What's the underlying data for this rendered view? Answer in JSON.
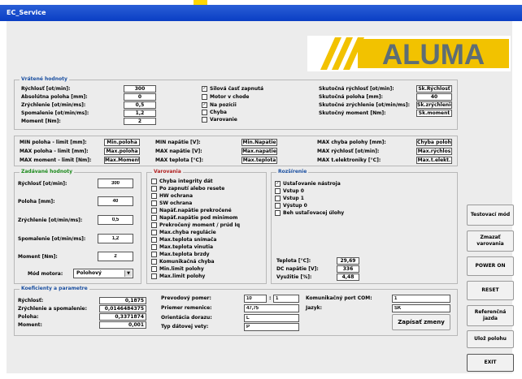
{
  "window": {
    "title": "EC_Service"
  },
  "logo": {
    "text": "ALUMA"
  },
  "vratene": {
    "title": "Vrátené hodnoty",
    "left": [
      {
        "label": "Rýchlosť [ot/min]:",
        "value": "300"
      },
      {
        "label": "Absolútna poloha [mm]:",
        "value": "0"
      },
      {
        "label": "Zrýchlenie [ot/min/ms]:",
        "value": "0,5"
      },
      {
        "label": "Spomalenie [ot/min/ms]:",
        "value": "1,2"
      },
      {
        "label": "Moment [Nm]:",
        "value": "2"
      }
    ],
    "checks": [
      {
        "label": "Silová časť zapnutá",
        "checked": true
      },
      {
        "label": "Motor v chode",
        "checked": false
      },
      {
        "label": "Na pozícii",
        "checked": true
      },
      {
        "label": "Chyba",
        "checked": false
      },
      {
        "label": "Varovanie",
        "checked": false
      }
    ],
    "right": [
      {
        "label": "Skutočná rýchlosť [ot/min]:",
        "value": "Sk.Rýchlosť"
      },
      {
        "label": "Skutočná poloha [mm]:",
        "value": "40"
      },
      {
        "label": "Skutočné zrýchlenie [ot/min/ms]:",
        "value": "Sk.zrýchlenie"
      },
      {
        "label": "Skutočný moment [Nm]:",
        "value": "Sk.moment"
      }
    ]
  },
  "limits": {
    "col1": [
      {
        "label": "MIN poloha - limit [mm]:",
        "value": "Min.poloha"
      },
      {
        "label": "MAX poloha - limit [mm]:",
        "value": "Max.poloha"
      },
      {
        "label": "MAX moment - limit [Nm]:",
        "value": "Max.Moment"
      }
    ],
    "col2": [
      {
        "label": "MIN napätie [V]:",
        "value": "Min.Napatie"
      },
      {
        "label": "MAX napätie [V]:",
        "value": "Max.napatie"
      },
      {
        "label": "MAX teplota [°C]:",
        "value": "Max.teplota"
      }
    ],
    "col3": [
      {
        "label": "MAX chyba polohy [mm]:",
        "value": "Chyba poloh"
      },
      {
        "label": "MAX rýchlosť [ot/min]:",
        "value": "Max.rýchlos"
      },
      {
        "label": "MAX t.elektroniky [°C]:",
        "value": "Max.t.elekt."
      }
    ]
  },
  "zadavane": {
    "title": "Zadávané hodnoty",
    "fields": [
      {
        "label": "Rýchlosť [ot/min]:",
        "value": "300"
      },
      {
        "label": "Poloha [mm]:",
        "value": "40"
      },
      {
        "label": "Zrýchlenie [ot/min/ms]:",
        "value": "0,5"
      },
      {
        "label": "Spomalenie [ot/min/ms]:",
        "value": "1,2"
      },
      {
        "label": "Moment [Nm]:",
        "value": "2"
      }
    ],
    "mode_label": "Mód motora:",
    "mode_value": "Polohový"
  },
  "varovania": {
    "title": "Varovania",
    "items": [
      "Chyba integrity dát",
      "Po zapnutí alebo resete",
      "HW ochrana",
      "SW ochrana",
      "Napäť.napätie prekročené",
      "Napäť.napätie pod minimom",
      "Prekročený moment / prúd Iq",
      "Max.chyba regulácie",
      "Max.teplota snímača",
      "Max.teplota vinutia",
      "Max.teplota brzdy",
      "Komunikačná chyba",
      "Min.limit polohy",
      "Max.limit polohy"
    ]
  },
  "rozsirenie": {
    "title": "Rozšírenie",
    "items": [
      {
        "label": "Ustaľovanie nástroja",
        "checked": true
      },
      {
        "label": "Vstup 0",
        "checked": false
      },
      {
        "label": "Vstup 1",
        "checked": false
      },
      {
        "label": "Výstup 0",
        "checked": false
      },
      {
        "label": "Beh ustaľovacej úlohy",
        "checked": false
      }
    ],
    "readouts": [
      {
        "label": "Teplota [°C]:",
        "value": "29,69"
      },
      {
        "label": "DC napätie [V]:",
        "value": "336"
      },
      {
        "label": "Využitie [%]:",
        "value": "4,48"
      }
    ]
  },
  "koeficienty": {
    "title": "Koeficienty a parametre",
    "left": [
      {
        "label": "Rýchlosť:",
        "value": "0,1875"
      },
      {
        "label": "Zrýchlenie a spomalenie:",
        "value": "0,0146484375"
      },
      {
        "label": "Poloha:",
        "value": "0,3371874"
      },
      {
        "label": "Moment:",
        "value": "0,001"
      }
    ],
    "prevod_label": "Prevodový pomer:",
    "prevod_a": "10",
    "prevod_sep": ":",
    "prevod_b": "1",
    "mid": [
      {
        "label": "Priemer remenice:",
        "value": "47,75"
      },
      {
        "label": "Orientácia dorazu:",
        "value": "L"
      },
      {
        "label": "Typ dátovej vety:",
        "value": "P"
      }
    ],
    "com_label": "Komunikačný port COM:",
    "com_value": "1",
    "lang_label": "Jazyk:",
    "lang_value": "SK",
    "save_label": "Zapísať zmeny"
  },
  "buttons": {
    "test_mode": "Testovací mód",
    "clear_warn": "Zmazať varovania",
    "power_on": "POWER ON",
    "reset": "RESET",
    "ref_drive": "Referenčná jazda",
    "save_pos": "Ulož polohu",
    "exit": "EXIT"
  }
}
